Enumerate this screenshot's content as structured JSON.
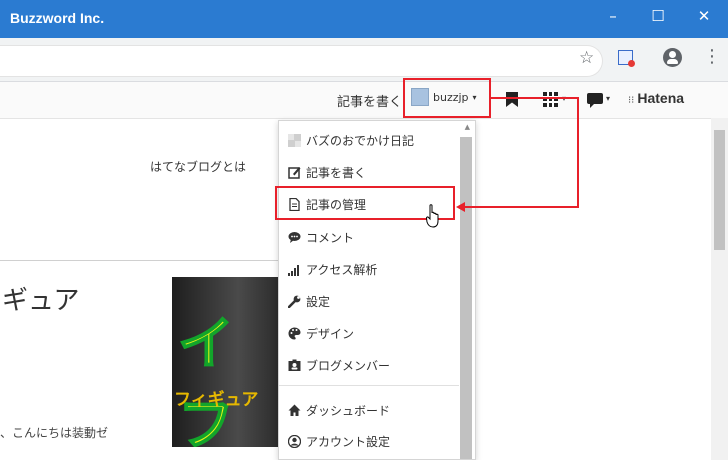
{
  "window": {
    "title": "Buzzword Inc.",
    "minimize": "–",
    "maximize": "☐",
    "close": "✕"
  },
  "browser": {
    "bookmark_star": "☆",
    "menu_dots": "⋮",
    "icons": [
      "star-icon",
      "extension-icon",
      "profile-icon",
      "more-vert-icon"
    ]
  },
  "hatena_bar": {
    "write_link": "記事を書く",
    "username": "buzzjp",
    "caret": "▾",
    "logo": "Hatena",
    "logo_mark": "⁝⁝"
  },
  "page": {
    "intro_link": "はてなブログとは",
    "heading_fragment": "ギュア",
    "body_fragment": "、こんにちは装動ゼ",
    "image_text_large": "イフ",
    "image_text_small": "フィギュア"
  },
  "menu": {
    "items": [
      {
        "label": "バズのおでかけ日記",
        "icon": "blog-thumbnail-icon"
      },
      {
        "label": "記事を書く",
        "icon": "edit-icon"
      },
      {
        "label": "記事の管理",
        "icon": "document-icon"
      },
      {
        "label": "コメント",
        "icon": "comment-icon"
      },
      {
        "label": "アクセス解析",
        "icon": "bar-chart-icon"
      },
      {
        "label": "設定",
        "icon": "wrench-icon"
      },
      {
        "label": "デザイン",
        "icon": "palette-icon"
      },
      {
        "label": "ブログメンバー",
        "icon": "member-card-icon"
      },
      {
        "label": "ダッシュボード",
        "icon": "home-icon"
      },
      {
        "label": "アカウント設定",
        "icon": "account-icon"
      }
    ],
    "hovered_item": "記事の管理"
  },
  "annotation": {
    "color": "#e8202a"
  },
  "colors": {
    "titlebar": "#2b7bd1",
    "highlight": "#e8202a"
  }
}
